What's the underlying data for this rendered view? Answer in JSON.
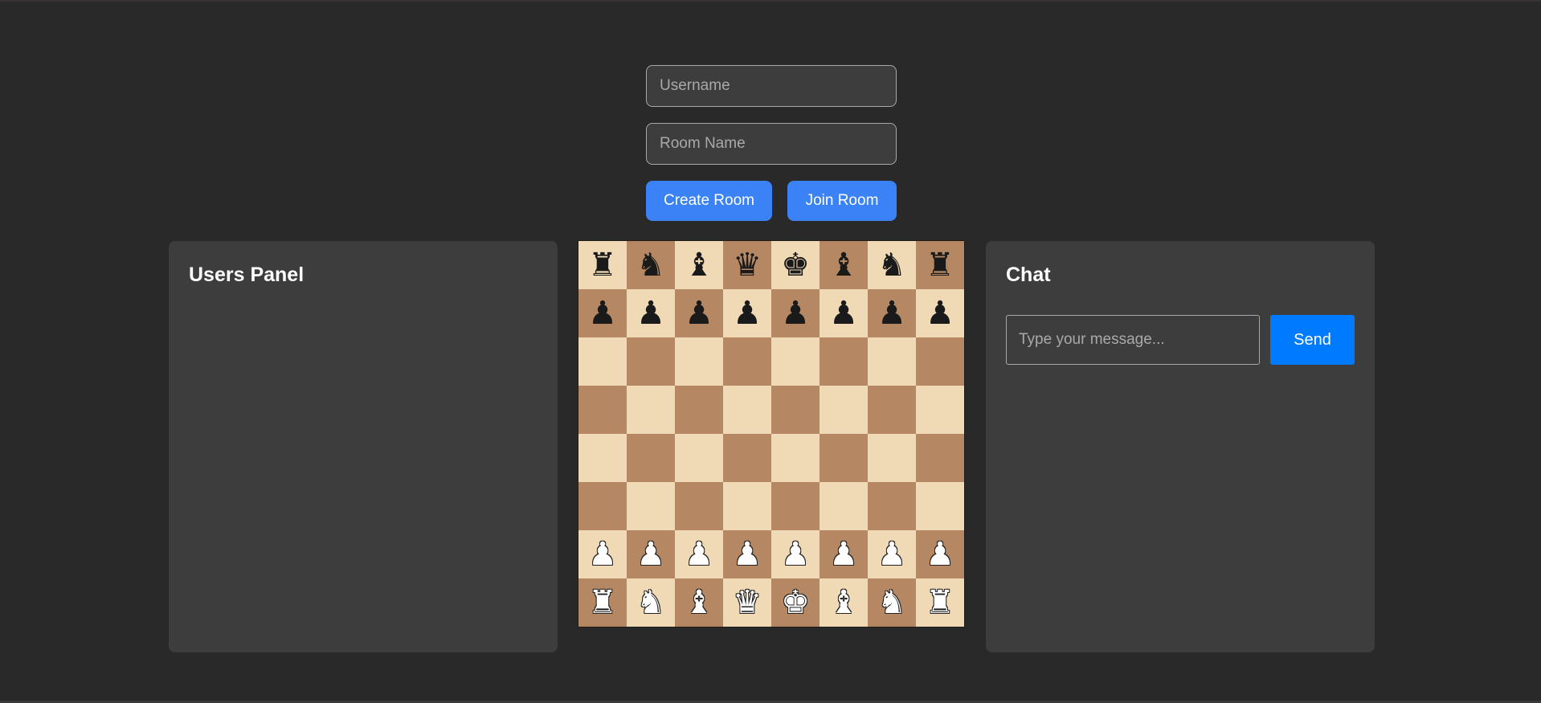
{
  "lobby": {
    "username_placeholder": "Username",
    "username_value": "",
    "room_placeholder": "Room Name",
    "room_value": "",
    "create_label": "Create Room",
    "join_label": "Join Room"
  },
  "users_panel": {
    "title": "Users Panel",
    "users": []
  },
  "chat": {
    "title": "Chat",
    "input_placeholder": "Type your message...",
    "input_value": "",
    "send_label": "Send",
    "messages": []
  },
  "board": {
    "light_color": "#f0d9b5",
    "dark_color": "#b58863",
    "rows": [
      [
        "r",
        "n",
        "b",
        "q",
        "k",
        "b",
        "n",
        "r"
      ],
      [
        "p",
        "p",
        "p",
        "p",
        "p",
        "p",
        "p",
        "p"
      ],
      [
        "",
        "",
        "",
        "",
        "",
        "",
        "",
        ""
      ],
      [
        "",
        "",
        "",
        "",
        "",
        "",
        "",
        ""
      ],
      [
        "",
        "",
        "",
        "",
        "",
        "",
        "",
        ""
      ],
      [
        "",
        "",
        "",
        "",
        "",
        "",
        "",
        ""
      ],
      [
        "P",
        "P",
        "P",
        "P",
        "P",
        "P",
        "P",
        "P"
      ],
      [
        "R",
        "N",
        "B",
        "Q",
        "K",
        "B",
        "N",
        "R"
      ]
    ]
  },
  "colors": {
    "background": "#292929",
    "panel": "#3d3d3d",
    "accent_blue": "#3b82f6",
    "send_blue": "#007bff"
  }
}
